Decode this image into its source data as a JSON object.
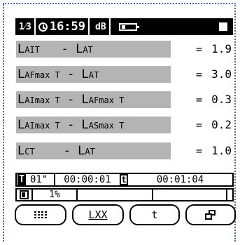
{
  "status_bar": {
    "page": "1⁄3",
    "time": "16:59",
    "unit": "dB"
  },
  "results": [
    {
      "label_a": "L",
      "sub_a": "AIT",
      "sep": "   - ",
      "label_b": "L",
      "sub_b": "AT",
      "eq": "=",
      "value": "1.9"
    },
    {
      "label_a": "L",
      "sub_a": "AFmax T",
      "sep": " - ",
      "label_b": "L",
      "sub_b": "AT",
      "eq": "=",
      "value": "3.0"
    },
    {
      "label_a": "L",
      "sub_a": "AImax T",
      "sep": " - ",
      "label_b": "L",
      "sub_b": "AFmax T",
      "eq": "=",
      "value": "0.3"
    },
    {
      "label_a": "L",
      "sub_a": "AImax T",
      "sep": " - ",
      "label_b": "L",
      "sub_b": "ASmax T",
      "eq": "=",
      "value": "0.2"
    },
    {
      "label_a": "L",
      "sub_a": "CT",
      "sep": "    - ",
      "label_b": "L",
      "sub_b": "AT",
      "eq": "=",
      "value": "1.0"
    }
  ],
  "timeline": {
    "interval_icon": "T",
    "interval": "01\"",
    "elapsed": "00:00:01",
    "total_icon": "t",
    "total": "00:01:04"
  },
  "progress": {
    "icon": "memory-icon",
    "percent": "1%"
  },
  "softkeys": {
    "menu_icon": "menu-grid-icon",
    "lxx": "LXX",
    "t": "t",
    "copy_icon": "copy-icon"
  }
}
